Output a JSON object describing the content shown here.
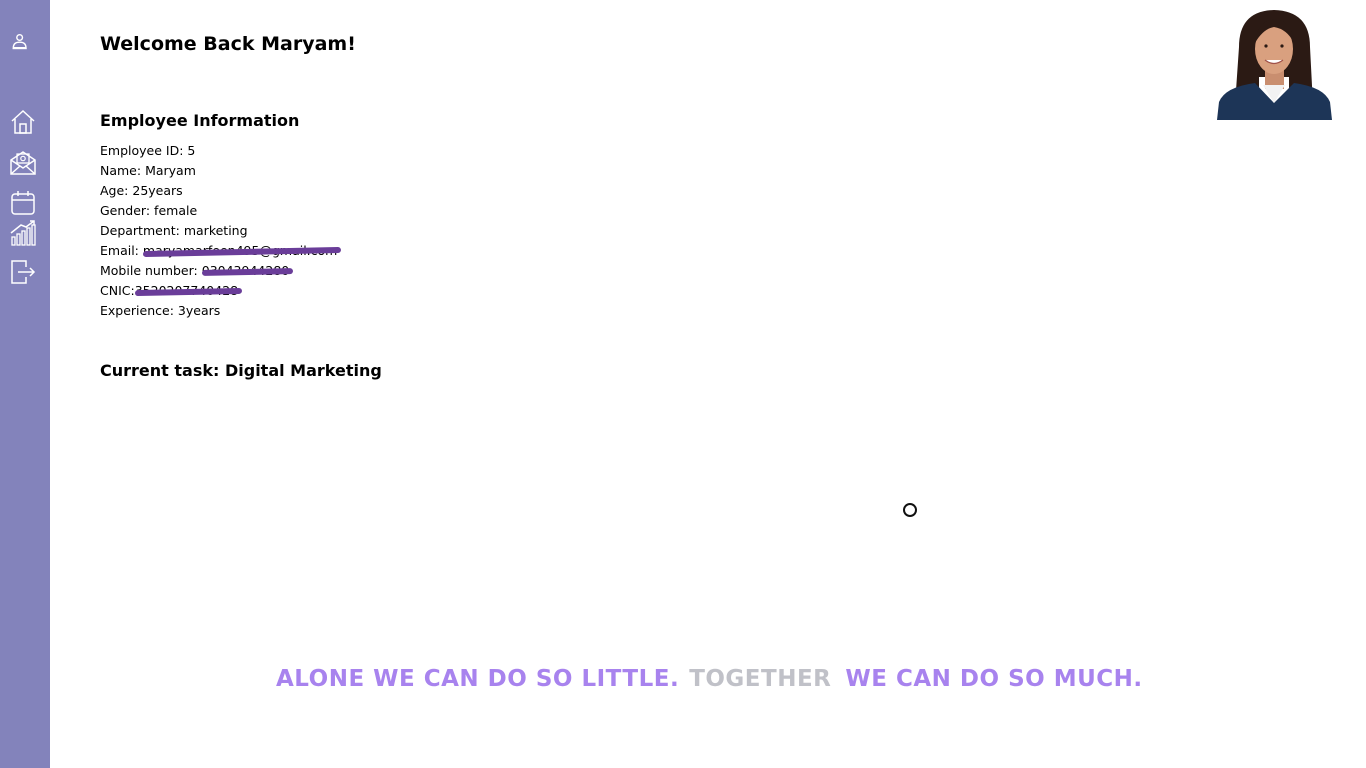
{
  "colors": {
    "sidebar": "#8383bb",
    "quote_accent": "#a883ee",
    "quote_muted": "#c0c1c8",
    "redaction": "#6a3d99"
  },
  "sidebar": {
    "icons": [
      "user-icon",
      "home-icon",
      "mail-icon",
      "calendar-icon",
      "analytics-icon",
      "logout-icon"
    ]
  },
  "header": {
    "welcome": "Welcome Back Maryam!"
  },
  "employee": {
    "section_title": "Employee Information",
    "fields": [
      {
        "label": "Employee ID:",
        "value": "5"
      },
      {
        "label": "Name:",
        "value": "Maryam"
      },
      {
        "label": "Age:",
        "value": "25years"
      },
      {
        "label": "Gender:",
        "value": "female"
      },
      {
        "label": "Department:",
        "value": "marketing"
      },
      {
        "label": "Email:",
        "value": "maryamarfeen495@gmail.com",
        "redacted": true
      },
      {
        "label": "Mobile number:",
        "value": "03043944280",
        "redacted": true
      },
      {
        "label": "CNIC:",
        "value": "3520207740428",
        "redacted": true
      },
      {
        "label": "Experience:",
        "value": "3years"
      }
    ]
  },
  "task": {
    "label": "Current task:",
    "value": "Digital Marketing"
  },
  "quote": {
    "part1": "ALONE WE CAN DO SO LITTLE.",
    "part2": "TOGETHER",
    "part3": "WE CAN DO SO MUCH."
  }
}
